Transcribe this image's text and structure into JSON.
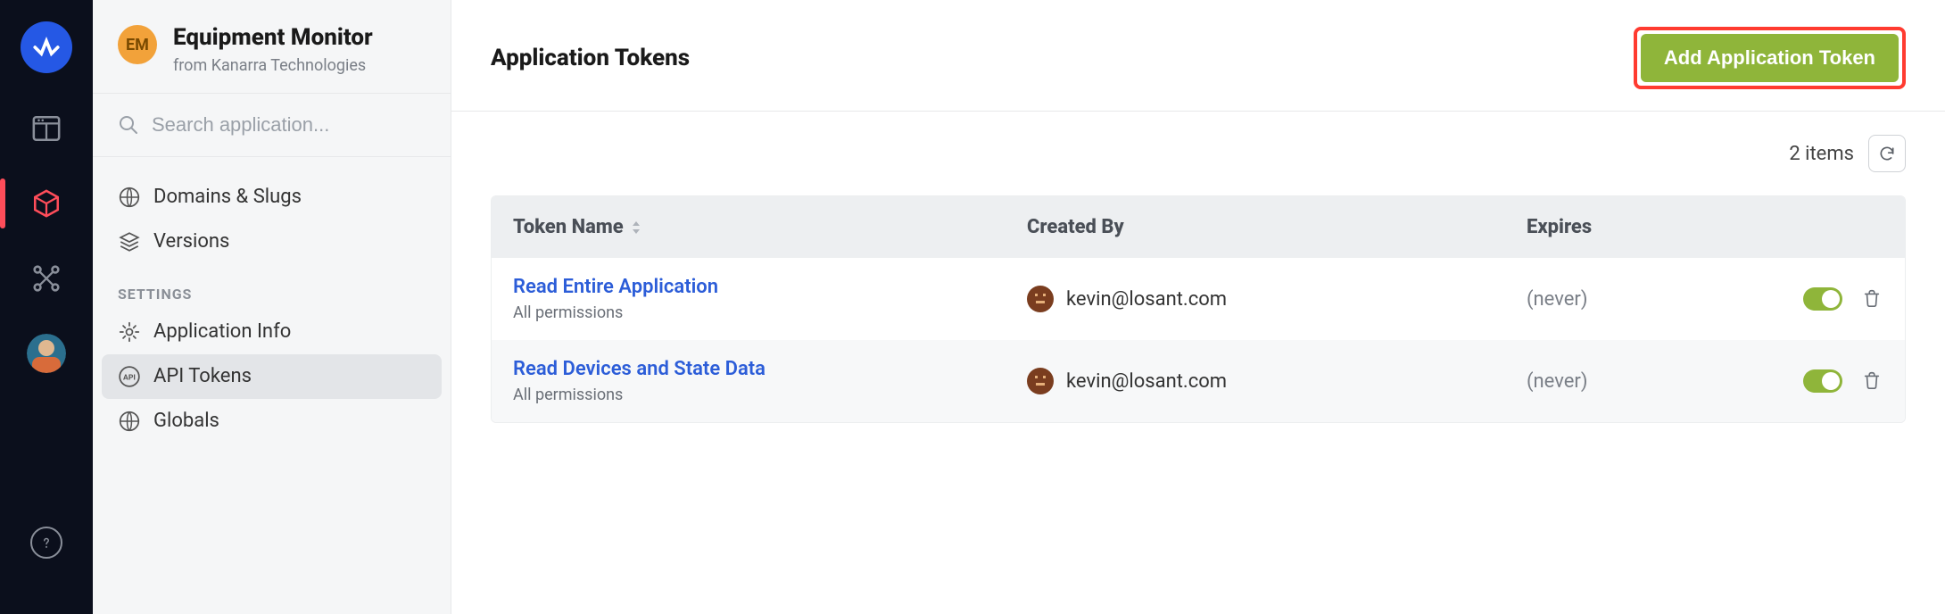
{
  "app": {
    "badge": "EM",
    "title": "Equipment Monitor",
    "subtitle": "from Kanarra Technologies",
    "search_placeholder": "Search application..."
  },
  "sidebar": {
    "nav1": [
      {
        "icon": "globe",
        "label": "Domains & Slugs"
      },
      {
        "icon": "layers",
        "label": "Versions"
      }
    ],
    "section_label": "SETTINGS",
    "nav2": [
      {
        "icon": "gear",
        "label": "Application Info"
      },
      {
        "icon": "api",
        "label": "API Tokens",
        "active": true
      },
      {
        "icon": "globe2",
        "label": "Globals"
      }
    ]
  },
  "page": {
    "title": "Application Tokens",
    "add_button": "Add Application Token",
    "count_label": "2 items"
  },
  "table": {
    "headers": {
      "name": "Token Name",
      "created_by": "Created By",
      "expires": "Expires"
    },
    "rows": [
      {
        "name": "Read Entire Application",
        "sub": "All permissions",
        "creator": "kevin@losant.com",
        "expires": "(never)",
        "enabled": true
      },
      {
        "name": "Read Devices and State Data",
        "sub": "All permissions",
        "creator": "kevin@losant.com",
        "expires": "(never)",
        "enabled": true
      }
    ]
  }
}
